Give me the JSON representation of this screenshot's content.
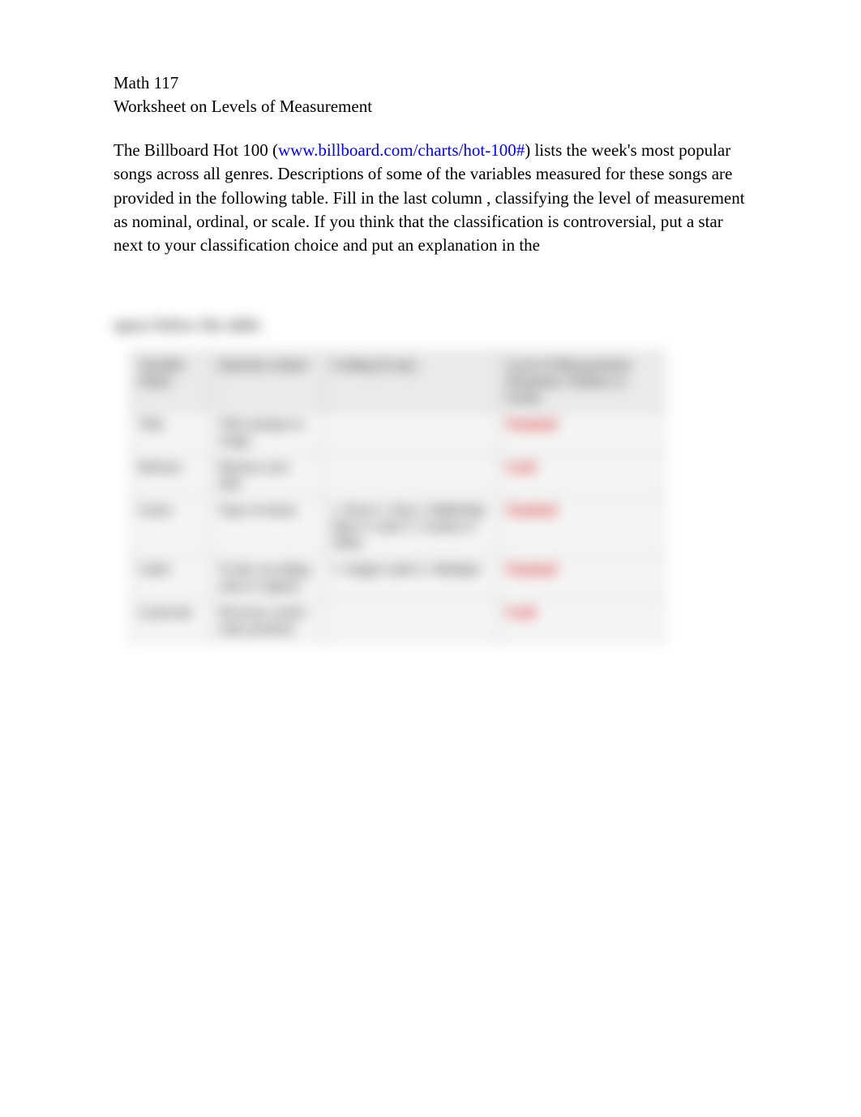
{
  "header": {
    "course": "Math 117",
    "title": "Worksheet on Levels of Measurement"
  },
  "intro": {
    "pre": "The Billboard Hot 100 (",
    "link_text": "www.billboard.com/charts/hot-100#",
    "post": ") lists the week's most popular songs across all genres.  Descriptions of some of the variables measured for these songs are provided in the following table.  Fill in the last column  , classifying the level of measurement as nominal, ordinal, or scale.  If you think that the classification is controversial, put a star next to your classification choice and put an explanation in the"
  },
  "blurred": {
    "below": "space below the table.",
    "columns": {
      "c1": "Variable Name",
      "c2": "Question Asked",
      "c3": "Coding (if any)",
      "c4": "Level of Measurement (Nominal, Ordinal, or Scale)"
    },
    "rows": [
      {
        "name": "Title",
        "question": "Title (unique to song)",
        "coding": "",
        "answer": "Nominal"
      },
      {
        "name": "Release",
        "question": "Release year date",
        "coding": "",
        "answer": "Scale"
      },
      {
        "name": "Genre",
        "question": "Type of music",
        "coding": "1. Rock\n2. Pop\n3. R&B/Hip-Hop\n4. Latin\n5. Country\n6. Other",
        "answer": "Nominal"
      },
      {
        "name": "Label",
        "question": "To the recording artist is signed",
        "coding": "1. Single Label\n2. Multiple",
        "answer": "Nominal"
      },
      {
        "name": "Lastweek",
        "question": "Previous week's chart position",
        "coding": "",
        "answer": "Scale"
      }
    ]
  }
}
